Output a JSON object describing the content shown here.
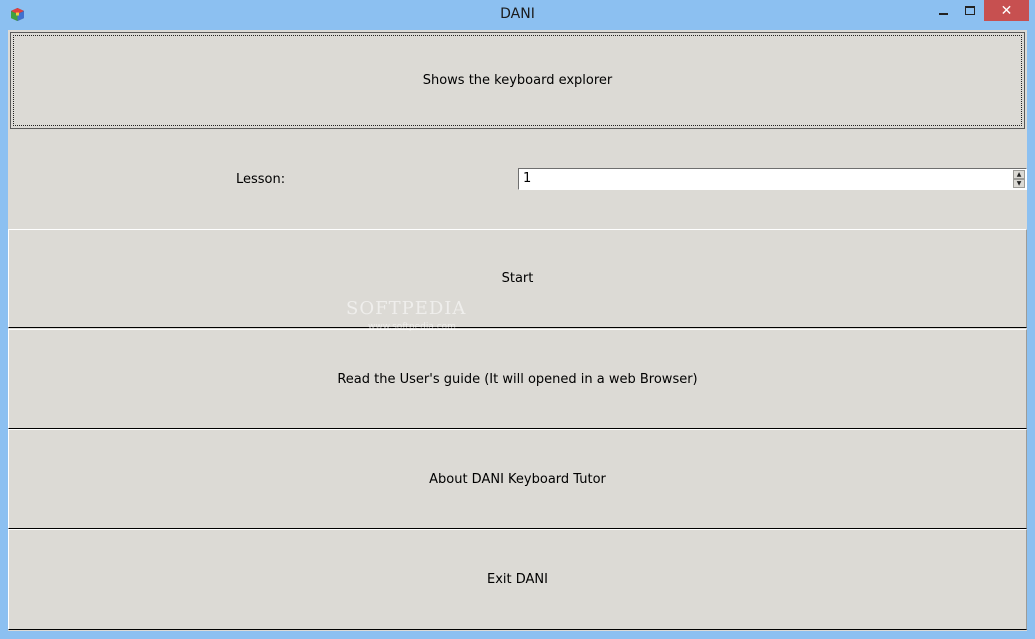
{
  "window": {
    "title": "DANI",
    "close_glyph": "✕"
  },
  "main": {
    "explorer_button": "Shows the keyboard explorer",
    "lesson_label": "Lesson:",
    "lesson_value": "1",
    "start_button": "Start",
    "guide_button": "Read the User's guide (It will opened in a web Browser)",
    "about_button": "About DANI Keyboard Tutor",
    "exit_button": "Exit DANI"
  },
  "watermark": {
    "text": "SOFTPEDIA",
    "url": "www.softpedia.com"
  },
  "colors": {
    "titlebar": "#8cc0f1",
    "client_bg": "#dcdad5",
    "close_button": "#c75050"
  }
}
